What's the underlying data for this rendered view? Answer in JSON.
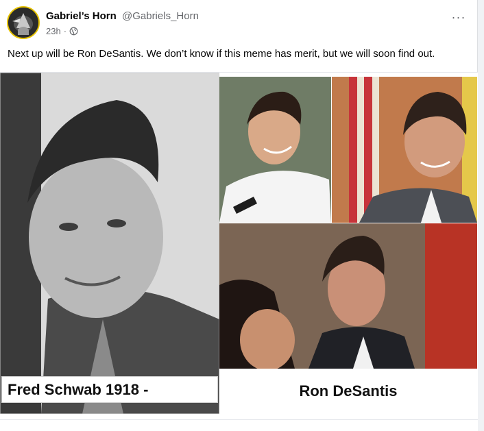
{
  "post": {
    "author_name": "Gabriel’s Horn",
    "author_handle": "@Gabriels_Horn",
    "timestamp": "23h",
    "separator": "·",
    "audience_icon": "globe-icon",
    "more_label": "···",
    "text": "Next up will be Ron DeSantis. We don’t know if this meme has merit, but we will soon find out."
  },
  "media": {
    "caption_left": "Fred Schwab 1918 -",
    "caption_right": "Ron DeSantis"
  }
}
